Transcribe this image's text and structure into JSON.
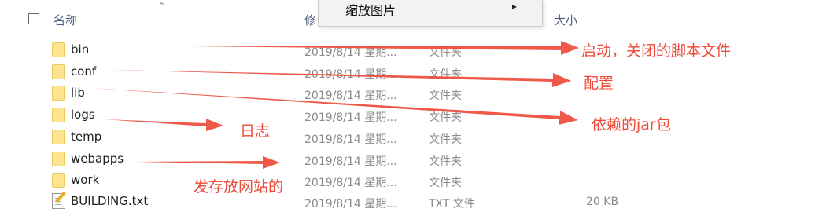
{
  "header": {
    "name_col": "名称",
    "date_col": "修",
    "size_col": "大小",
    "sort_arrow": "^"
  },
  "context_menu": {
    "item_label": "缩放图片",
    "submenu_arrow": "▸"
  },
  "files": [
    {
      "name": "bin",
      "date": "2019/8/14 星期...",
      "type": "文件夹",
      "size": "",
      "icon": "folder-icon"
    },
    {
      "name": "conf",
      "date": "2019/8/14 星期...",
      "type": "文件夹",
      "size": "",
      "icon": "folder-icon"
    },
    {
      "name": "lib",
      "date": "2019/8/14 星期...",
      "type": "文件夹",
      "size": "",
      "icon": "folder-icon"
    },
    {
      "name": "logs",
      "date": "2019/8/14 星期...",
      "type": "文件夹",
      "size": "",
      "icon": "folder-icon"
    },
    {
      "name": "temp",
      "date": "2019/8/14 星期...",
      "type": "文件夹",
      "size": "",
      "icon": "folder-icon"
    },
    {
      "name": "webapps",
      "date": "2019/8/14 星期...",
      "type": "文件夹",
      "size": "",
      "icon": "folder-icon"
    },
    {
      "name": "work",
      "date": "2019/8/14 星期...",
      "type": "文件夹",
      "size": "",
      "icon": "folder-icon"
    },
    {
      "name": "BUILDING.txt",
      "date": "2019/8/14 星期...",
      "type": "TXT 文件",
      "size": "20 KB",
      "icon": "text-file-icon"
    }
  ],
  "annotations": {
    "bin": "启动，关闭的脚本文件",
    "conf": "配置",
    "lib": "依赖的jar包",
    "logs": "日志",
    "webapps": "发存放网站的"
  },
  "colors": {
    "annotation": "#ef4b3a",
    "folder": "#fbe38f",
    "header_text": "#4d6082",
    "secondary_text": "#8a8a8a"
  }
}
